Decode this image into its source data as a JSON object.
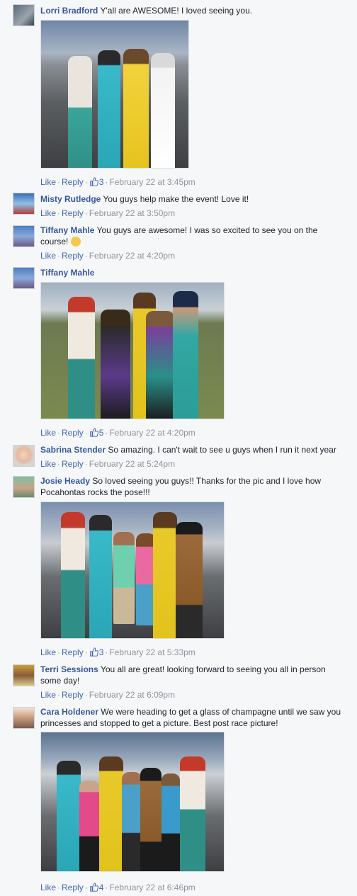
{
  "actions": {
    "like": "Like",
    "reply": "Reply",
    "sep": "·"
  },
  "comments": [
    {
      "author": "Lorri Bradford",
      "text": "Y'all are AWESOME! I loved seeing you.",
      "likes": "3",
      "time": "February 22 at 3:45pm"
    },
    {
      "author": "Misty Rutledge",
      "text": "You guys help make the event! Love it!",
      "time": "February 22 at 3:50pm"
    },
    {
      "author": "Tiffany Mahle",
      "text": "You guys are awesome! I was so excited to see you on the course!",
      "time": "February 22 at 4:20pm"
    },
    {
      "author": "Tiffany Mahle",
      "text": "",
      "likes": "5",
      "time": "February 22 at 4:20pm"
    },
    {
      "author": "Sabrina Stender",
      "text": "So amazing. I can't wait to see u guys when I run it next year",
      "time": "February 22 at 5:24pm"
    },
    {
      "author": "Josie Heady",
      "text": "So loved seeing you guys!! Thanks for the pic and I love how Pocahontas rocks the pose!!!",
      "likes": "3",
      "time": "February 22 at 5:33pm"
    },
    {
      "author": "Terri Sessions",
      "text": "You all are great! looking forward to seeing you all in person some day!",
      "time": "February 22 at 6:09pm"
    },
    {
      "author": "Cara Holdener",
      "text": "We were heading to get a glass of champagne until we saw you princesses and stopped to get a picture. Best post race picture!",
      "likes": "4",
      "time": "February 22 at 6:46pm"
    }
  ]
}
